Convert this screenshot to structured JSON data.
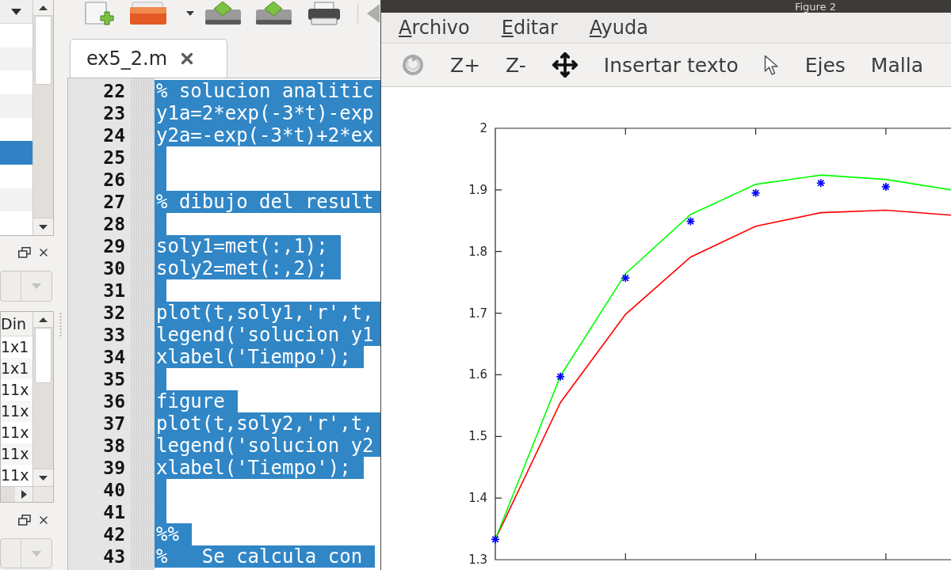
{
  "file_list": {
    "rows": [
      {
        "selected": false
      },
      {
        "selected": false
      },
      {
        "selected": false
      },
      {
        "selected": false
      },
      {
        "selected": false
      },
      {
        "selected": true
      },
      {
        "selected": false
      },
      {
        "selected": false
      },
      {
        "selected": false
      }
    ]
  },
  "workspace_table": {
    "columns": [
      "Din"
    ],
    "rows": [
      [
        "1x1"
      ],
      [
        "1x1"
      ],
      [
        "11x"
      ],
      [
        "11x"
      ],
      [
        "11x"
      ],
      [
        "11x"
      ],
      [
        "11x"
      ]
    ]
  },
  "editor": {
    "tab": {
      "label": "ex5_2.m",
      "selected": true
    },
    "lines": [
      {
        "number": "22",
        "text": "% solucion analitic",
        "selected": true
      },
      {
        "number": "23",
        "text": "y1a=2*exp(-3*t)-exp",
        "selected": true
      },
      {
        "number": "24",
        "text": "y2a=-exp(-3*t)+2*ex",
        "selected": true
      },
      {
        "number": "25",
        "selected": true
      },
      {
        "number": "26",
        "selected": true
      },
      {
        "number": "27",
        "text": "% dibujo del result",
        "selected": true
      },
      {
        "number": "28",
        "selected": true
      },
      {
        "number": "29",
        "text": "soly1=met(:,1);",
        "selected": true
      },
      {
        "number": "30",
        "text": "soly2=met(:,2);",
        "selected": true
      },
      {
        "number": "31",
        "selected": true
      },
      {
        "number": "32",
        "text": "plot(t,soly1,'r',t,",
        "selected": true
      },
      {
        "number": "33",
        "text": "legend('solucion y1",
        "selected": true
      },
      {
        "number": "34",
        "text": "xlabel('Tiempo');",
        "selected": true
      },
      {
        "number": "35",
        "selected": true
      },
      {
        "number": "36",
        "text": "figure",
        "selected": true
      },
      {
        "number": "37",
        "text": "plot(t,soly2,'r',t,",
        "selected": true
      },
      {
        "number": "38",
        "text": "legend('solucion y2",
        "selected": true
      },
      {
        "number": "39",
        "text": "xlabel('Tiempo');",
        "selected": true
      },
      {
        "number": "40",
        "selected": true
      },
      {
        "number": "41",
        "selected": true
      },
      {
        "number": "42",
        "text": "%%",
        "selected": true
      },
      {
        "number": "43",
        "text": "%   Se calcula con",
        "selected": true
      }
    ]
  },
  "figure_window": {
    "title": "Figure 2",
    "menu": [
      "Archivo",
      "Editar",
      "Ayuda"
    ],
    "toolbar": [
      {
        "kind": "icon"
      },
      {
        "kind": "text",
        "label": "Z+"
      },
      {
        "kind": "text",
        "label": "Z-"
      },
      {
        "kind": "icon"
      },
      {
        "kind": "text",
        "label": "Insertar texto"
      },
      {
        "kind": "icon"
      },
      {
        "kind": "text",
        "label": "Ejes"
      },
      {
        "kind": "text",
        "label": "Malla"
      }
    ],
    "chart_data": {
      "type": "line",
      "ylim": [
        1.3,
        2
      ],
      "yticks": [
        1.3,
        1.4,
        1.5,
        1.6,
        1.7,
        1.8,
        1.9,
        2
      ],
      "series": [
        {
          "type": "line",
          "color": "#ff0000",
          "values": [
            1.333,
            1.555,
            1.698,
            1.791,
            1.841,
            1.863,
            1.867,
            1.859
          ]
        },
        {
          "type": "line",
          "color": "#00ff00",
          "values": [
            1.333,
            1.598,
            1.764,
            1.86,
            1.909,
            1.924,
            1.917,
            1.9
          ]
        },
        {
          "type": "scatter",
          "color": "#0000ff",
          "values": [
            1.333,
            1.597,
            1.757,
            1.849,
            1.895,
            1.911,
            1.905
          ]
        }
      ]
    }
  }
}
